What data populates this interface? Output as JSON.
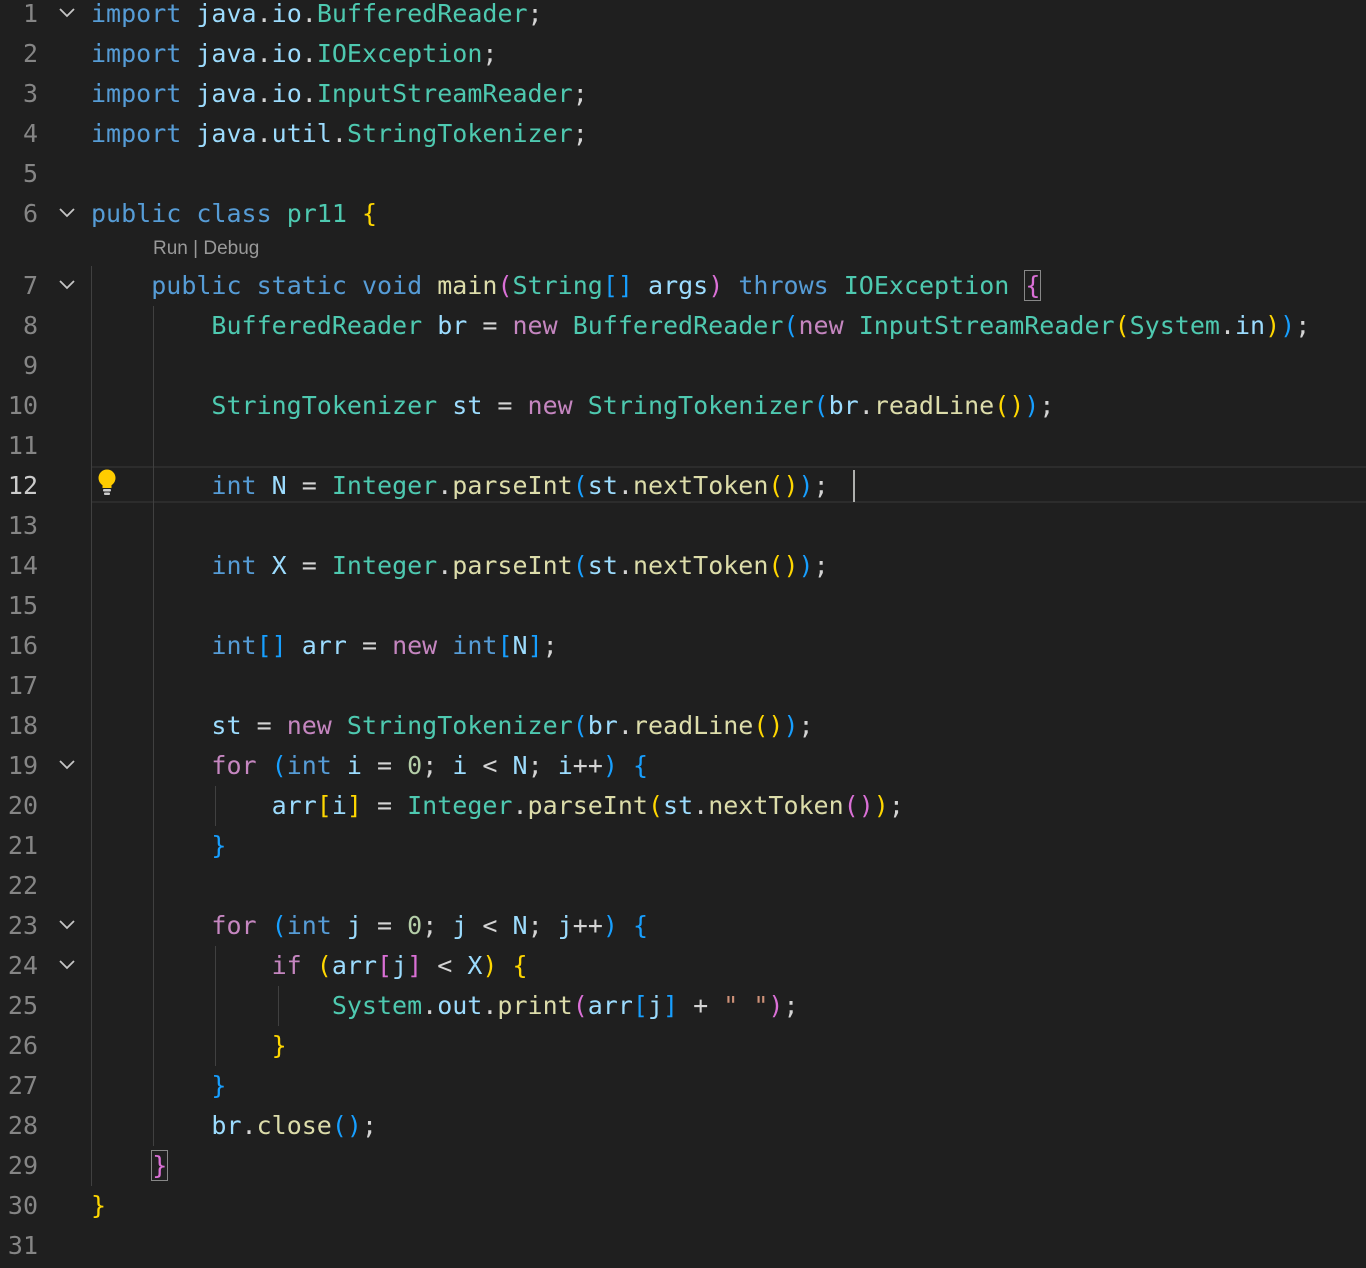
{
  "editor": {
    "language": "java",
    "active_line": 12,
    "codelens": {
      "run_label": "Run",
      "separator": " | ",
      "debug_label": "Debug"
    },
    "lines": [
      {
        "n": "1",
        "tokens": [
          [
            "import",
            "k"
          ],
          [
            " ",
            "p"
          ],
          [
            "java",
            "v"
          ],
          [
            ".",
            "p"
          ],
          [
            "io",
            "v"
          ],
          [
            ".",
            "p"
          ],
          [
            "BufferedReader",
            "t"
          ],
          [
            ";",
            "p"
          ]
        ]
      },
      {
        "n": "2",
        "tokens": [
          [
            "import",
            "k"
          ],
          [
            " ",
            "p"
          ],
          [
            "java",
            "v"
          ],
          [
            ".",
            "p"
          ],
          [
            "io",
            "v"
          ],
          [
            ".",
            "p"
          ],
          [
            "IOException",
            "t"
          ],
          [
            ";",
            "p"
          ]
        ]
      },
      {
        "n": "3",
        "tokens": [
          [
            "import",
            "k"
          ],
          [
            " ",
            "p"
          ],
          [
            "java",
            "v"
          ],
          [
            ".",
            "p"
          ],
          [
            "io",
            "v"
          ],
          [
            ".",
            "p"
          ],
          [
            "InputStreamReader",
            "t"
          ],
          [
            ";",
            "p"
          ]
        ]
      },
      {
        "n": "4",
        "tokens": [
          [
            "import",
            "k"
          ],
          [
            " ",
            "p"
          ],
          [
            "java",
            "v"
          ],
          [
            ".",
            "p"
          ],
          [
            "util",
            "v"
          ],
          [
            ".",
            "p"
          ],
          [
            "StringTokenizer",
            "t"
          ],
          [
            ";",
            "p"
          ]
        ]
      },
      {
        "n": "5",
        "tokens": []
      },
      {
        "n": "6",
        "tokens": [
          [
            "public",
            "k"
          ],
          [
            " ",
            "p"
          ],
          [
            "class",
            "k"
          ],
          [
            " ",
            "p"
          ],
          [
            "pr11",
            "t"
          ],
          [
            " ",
            "p"
          ],
          [
            "{",
            "b1"
          ]
        ]
      },
      {
        "n": "7",
        "tokens": [
          [
            "    ",
            "p"
          ],
          [
            "public",
            "k"
          ],
          [
            " ",
            "p"
          ],
          [
            "static",
            "k"
          ],
          [
            " ",
            "p"
          ],
          [
            "void",
            "k"
          ],
          [
            " ",
            "p"
          ],
          [
            "main",
            "f"
          ],
          [
            "(",
            "b2"
          ],
          [
            "String",
            "t"
          ],
          [
            "[]",
            "b3"
          ],
          [
            " ",
            "p"
          ],
          [
            "args",
            "v"
          ],
          [
            ")",
            "b2"
          ],
          [
            " ",
            "p"
          ],
          [
            "throws",
            "k"
          ],
          [
            " ",
            "p"
          ],
          [
            "IOException",
            "t"
          ],
          [
            " ",
            "p"
          ],
          [
            "{",
            "b2 bb"
          ]
        ]
      },
      {
        "n": "8",
        "tokens": [
          [
            "        ",
            "p"
          ],
          [
            "BufferedReader",
            "t"
          ],
          [
            " ",
            "p"
          ],
          [
            "br",
            "v"
          ],
          [
            " = ",
            "p"
          ],
          [
            "new",
            "c"
          ],
          [
            " ",
            "p"
          ],
          [
            "BufferedReader",
            "t"
          ],
          [
            "(",
            "b3"
          ],
          [
            "new",
            "c"
          ],
          [
            " ",
            "p"
          ],
          [
            "InputStreamReader",
            "t"
          ],
          [
            "(",
            "b1"
          ],
          [
            "System",
            "t"
          ],
          [
            ".",
            "p"
          ],
          [
            "in",
            "v"
          ],
          [
            ")",
            "b1"
          ],
          [
            ")",
            "b3"
          ],
          [
            ";",
            "p"
          ]
        ]
      },
      {
        "n": "9",
        "tokens": []
      },
      {
        "n": "10",
        "tokens": [
          [
            "        ",
            "p"
          ],
          [
            "StringTokenizer",
            "t"
          ],
          [
            " ",
            "p"
          ],
          [
            "st",
            "v"
          ],
          [
            " = ",
            "p"
          ],
          [
            "new",
            "c"
          ],
          [
            " ",
            "p"
          ],
          [
            "StringTokenizer",
            "t"
          ],
          [
            "(",
            "b3"
          ],
          [
            "br",
            "v"
          ],
          [
            ".",
            "p"
          ],
          [
            "readLine",
            "f"
          ],
          [
            "()",
            "b1"
          ],
          [
            ")",
            "b3"
          ],
          [
            ";",
            "p"
          ]
        ]
      },
      {
        "n": "11",
        "tokens": []
      },
      {
        "n": "12",
        "tokens": [
          [
            "        ",
            "p"
          ],
          [
            "int",
            "k"
          ],
          [
            " ",
            "p"
          ],
          [
            "N",
            "v"
          ],
          [
            " = ",
            "p"
          ],
          [
            "Integer",
            "t"
          ],
          [
            ".",
            "p"
          ],
          [
            "parseInt",
            "f"
          ],
          [
            "(",
            "b3"
          ],
          [
            "st",
            "v"
          ],
          [
            ".",
            "p"
          ],
          [
            "nextToken",
            "f"
          ],
          [
            "()",
            "b1"
          ],
          [
            ")",
            "b3"
          ],
          [
            ";",
            "p"
          ]
        ]
      },
      {
        "n": "13",
        "tokens": []
      },
      {
        "n": "14",
        "tokens": [
          [
            "        ",
            "p"
          ],
          [
            "int",
            "k"
          ],
          [
            " ",
            "p"
          ],
          [
            "X",
            "v"
          ],
          [
            " = ",
            "p"
          ],
          [
            "Integer",
            "t"
          ],
          [
            ".",
            "p"
          ],
          [
            "parseInt",
            "f"
          ],
          [
            "(",
            "b3"
          ],
          [
            "st",
            "v"
          ],
          [
            ".",
            "p"
          ],
          [
            "nextToken",
            "f"
          ],
          [
            "()",
            "b1"
          ],
          [
            ")",
            "b3"
          ],
          [
            ";",
            "p"
          ]
        ]
      },
      {
        "n": "15",
        "tokens": []
      },
      {
        "n": "16",
        "tokens": [
          [
            "        ",
            "p"
          ],
          [
            "int",
            "k"
          ],
          [
            "[]",
            "b3"
          ],
          [
            " ",
            "p"
          ],
          [
            "arr",
            "v"
          ],
          [
            " = ",
            "p"
          ],
          [
            "new",
            "c"
          ],
          [
            " ",
            "p"
          ],
          [
            "int",
            "k"
          ],
          [
            "[",
            "b3"
          ],
          [
            "N",
            "v"
          ],
          [
            "]",
            "b3"
          ],
          [
            ";",
            "p"
          ]
        ]
      },
      {
        "n": "17",
        "tokens": []
      },
      {
        "n": "18",
        "tokens": [
          [
            "        ",
            "p"
          ],
          [
            "st",
            "v"
          ],
          [
            " = ",
            "p"
          ],
          [
            "new",
            "c"
          ],
          [
            " ",
            "p"
          ],
          [
            "StringTokenizer",
            "t"
          ],
          [
            "(",
            "b3"
          ],
          [
            "br",
            "v"
          ],
          [
            ".",
            "p"
          ],
          [
            "readLine",
            "f"
          ],
          [
            "()",
            "b1"
          ],
          [
            ")",
            "b3"
          ],
          [
            ";",
            "p"
          ]
        ]
      },
      {
        "n": "19",
        "tokens": [
          [
            "        ",
            "p"
          ],
          [
            "for",
            "c"
          ],
          [
            " ",
            "p"
          ],
          [
            "(",
            "b3"
          ],
          [
            "int",
            "k"
          ],
          [
            " ",
            "p"
          ],
          [
            "i",
            "v"
          ],
          [
            " = ",
            "p"
          ],
          [
            "0",
            "n"
          ],
          [
            "; ",
            "p"
          ],
          [
            "i",
            "v"
          ],
          [
            " < ",
            "p"
          ],
          [
            "N",
            "v"
          ],
          [
            "; ",
            "p"
          ],
          [
            "i",
            "v"
          ],
          [
            "++",
            "p"
          ],
          [
            ")",
            "b3"
          ],
          [
            " ",
            "p"
          ],
          [
            "{",
            "b3"
          ]
        ]
      },
      {
        "n": "20",
        "tokens": [
          [
            "            ",
            "p"
          ],
          [
            "arr",
            "v"
          ],
          [
            "[",
            "b1"
          ],
          [
            "i",
            "v"
          ],
          [
            "]",
            "b1"
          ],
          [
            " = ",
            "p"
          ],
          [
            "Integer",
            "t"
          ],
          [
            ".",
            "p"
          ],
          [
            "parseInt",
            "f"
          ],
          [
            "(",
            "b1"
          ],
          [
            "st",
            "v"
          ],
          [
            ".",
            "p"
          ],
          [
            "nextToken",
            "f"
          ],
          [
            "()",
            "b2"
          ],
          [
            ")",
            "b1"
          ],
          [
            ";",
            "p"
          ]
        ]
      },
      {
        "n": "21",
        "tokens": [
          [
            "        ",
            "p"
          ],
          [
            "}",
            "b3"
          ]
        ]
      },
      {
        "n": "22",
        "tokens": []
      },
      {
        "n": "23",
        "tokens": [
          [
            "        ",
            "p"
          ],
          [
            "for",
            "c"
          ],
          [
            " ",
            "p"
          ],
          [
            "(",
            "b3"
          ],
          [
            "int",
            "k"
          ],
          [
            " ",
            "p"
          ],
          [
            "j",
            "v"
          ],
          [
            " = ",
            "p"
          ],
          [
            "0",
            "n"
          ],
          [
            "; ",
            "p"
          ],
          [
            "j",
            "v"
          ],
          [
            " < ",
            "p"
          ],
          [
            "N",
            "v"
          ],
          [
            "; ",
            "p"
          ],
          [
            "j",
            "v"
          ],
          [
            "++",
            "p"
          ],
          [
            ")",
            "b3"
          ],
          [
            " ",
            "p"
          ],
          [
            "{",
            "b3"
          ]
        ]
      },
      {
        "n": "24",
        "tokens": [
          [
            "            ",
            "p"
          ],
          [
            "if",
            "c"
          ],
          [
            " ",
            "p"
          ],
          [
            "(",
            "b1"
          ],
          [
            "arr",
            "v"
          ],
          [
            "[",
            "b2"
          ],
          [
            "j",
            "v"
          ],
          [
            "]",
            "b2"
          ],
          [
            " < ",
            "p"
          ],
          [
            "X",
            "v"
          ],
          [
            ")",
            "b1"
          ],
          [
            " ",
            "p"
          ],
          [
            "{",
            "b1"
          ]
        ]
      },
      {
        "n": "25",
        "tokens": [
          [
            "                ",
            "p"
          ],
          [
            "System",
            "t"
          ],
          [
            ".",
            "p"
          ],
          [
            "out",
            "v"
          ],
          [
            ".",
            "p"
          ],
          [
            "print",
            "f"
          ],
          [
            "(",
            "b2"
          ],
          [
            "arr",
            "v"
          ],
          [
            "[",
            "b3"
          ],
          [
            "j",
            "v"
          ],
          [
            "]",
            "b3"
          ],
          [
            " + ",
            "p"
          ],
          [
            "\" \"",
            "s"
          ],
          [
            ")",
            "b2"
          ],
          [
            ";",
            "p"
          ]
        ]
      },
      {
        "n": "26",
        "tokens": [
          [
            "            ",
            "p"
          ],
          [
            "}",
            "b1"
          ]
        ]
      },
      {
        "n": "27",
        "tokens": [
          [
            "        ",
            "p"
          ],
          [
            "}",
            "b3"
          ]
        ]
      },
      {
        "n": "28",
        "tokens": [
          [
            "        ",
            "p"
          ],
          [
            "br",
            "v"
          ],
          [
            ".",
            "p"
          ],
          [
            "close",
            "f"
          ],
          [
            "()",
            "b3"
          ],
          [
            ";",
            "p"
          ]
        ]
      },
      {
        "n": "29",
        "tokens": [
          [
            "    ",
            "p"
          ],
          [
            "}",
            "b2 bb"
          ]
        ]
      },
      {
        "n": "30",
        "tokens": [
          [
            "}",
            "b1"
          ]
        ]
      },
      {
        "n": "31",
        "tokens": []
      }
    ]
  }
}
